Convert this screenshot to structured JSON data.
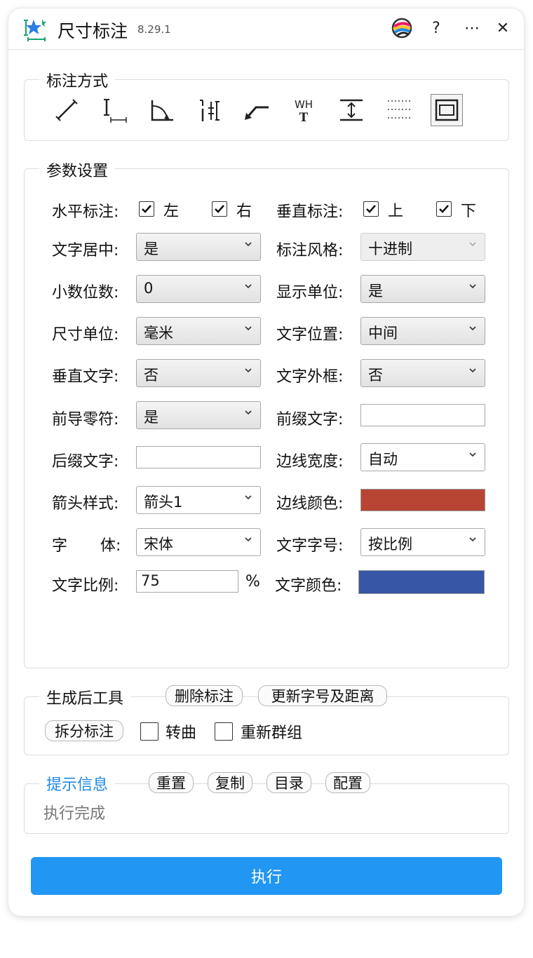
{
  "window": {
    "title": "尺寸标注",
    "version": "8.29.1"
  },
  "titlebar_icons": [
    "app-logo-icon",
    "color-wheel-icon",
    "help-icon",
    "more-icon",
    "close-icon"
  ],
  "titlebar": {
    "help": "?",
    "more": "⋯",
    "close": "✕"
  },
  "mode_group": {
    "title": "标注方式",
    "icons": [
      "aligned-dimension-icon",
      "linear-dimension-icon",
      "angle-dimension-icon",
      "spacing-dimension-icon",
      "leader-dimension-icon",
      "wh-text-dimension-icon",
      "vertical-span-dimension-icon",
      "dotted-grid-icon",
      "frame-dimension-icon"
    ],
    "wh_text": "WH",
    "wh_t": "T",
    "selected_index": 8
  },
  "params": {
    "title": "参数设置",
    "horizontal": {
      "label": "水平标注:",
      "left": "左",
      "right": "右",
      "left_checked": true,
      "right_checked": true
    },
    "vertical": {
      "label": "垂直标注:",
      "top": "上",
      "bottom": "下",
      "top_checked": true,
      "bottom_checked": true
    },
    "text_center": {
      "label": "文字居中:",
      "value": "是"
    },
    "dim_style": {
      "label": "标注风格:",
      "value": "十进制"
    },
    "decimals": {
      "label": "小数位数:",
      "value": "0"
    },
    "show_unit": {
      "label": "显示单位:",
      "value": "是"
    },
    "size_unit": {
      "label": "尺寸单位:",
      "value": "毫米"
    },
    "text_position": {
      "label": "文字位置:",
      "value": "中间"
    },
    "vertical_text": {
      "label": "垂直文字:",
      "value": "否"
    },
    "text_frame": {
      "label": "文字外框:",
      "value": "否"
    },
    "leading_zero": {
      "label": "前导零符:",
      "value": "是"
    },
    "prefix": {
      "label": "前缀文字:",
      "value": ""
    },
    "suffix": {
      "label": "后缀文字:",
      "value": ""
    },
    "border_width": {
      "label": "边线宽度:",
      "value": "自动"
    },
    "arrow_style": {
      "label": "箭头样式:",
      "value": "箭头1"
    },
    "border_color": {
      "label": "边线颜色:",
      "color": "#b84434"
    },
    "font_label_a": "字",
    "font_label_b": "体:",
    "font": {
      "value": "宋体"
    },
    "text_size": {
      "label": "文字字号:",
      "value": "按比例"
    },
    "text_scale": {
      "label": "文字比例:",
      "value": "75",
      "unit": "%"
    },
    "text_color": {
      "label": "文字颜色:",
      "color": "#3756a5"
    }
  },
  "post_tools": {
    "title": "生成后工具",
    "delete_btn": "删除标注",
    "update_btn": "更新字号及距离",
    "split_btn": "拆分标注",
    "curve_label": "转曲",
    "curve_checked": false,
    "regroup_label": "重新群组",
    "regroup_checked": false
  },
  "info": {
    "title": "提示信息",
    "reset_btn": "重置",
    "copy_btn": "复制",
    "dir_btn": "目录",
    "config_btn": "配置",
    "message": "执行完成",
    "title_color": "#1e88e5"
  },
  "execute_label": "执行",
  "colors": {
    "accent": "#2196f3"
  }
}
